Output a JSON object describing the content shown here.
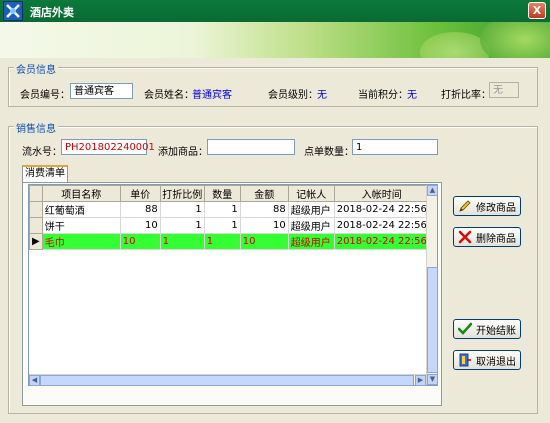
{
  "window": {
    "title": "酒店外卖",
    "close_label": "X"
  },
  "member": {
    "group_title": "会员信息",
    "id_label": "会员编号：",
    "id_value": "普通宾客",
    "name_label": "会员姓名：",
    "name_value": "普通宾客",
    "level_label": "会员级别：",
    "level_value": "无",
    "points_label": "当前积分：",
    "points_value": "无",
    "discount_label": "打折比率：",
    "discount_value": "无"
  },
  "sales": {
    "group_title": "销售信息",
    "serial_label": "流水号：",
    "serial_value": "PH201802240001",
    "add_label": "添加商品：",
    "add_value": "",
    "qty_label": "点单数量：",
    "qty_value": "1"
  },
  "tab": {
    "label": "消费清单"
  },
  "table": {
    "columns": [
      "项目名称",
      "单价",
      "打折比例",
      "数量",
      "金额",
      "记帐人",
      "入帐时间"
    ],
    "rows": [
      {
        "name": "红葡萄酒",
        "price": "88",
        "discount": "1",
        "qty": "1",
        "amount": "88",
        "clerk": "超级用户",
        "time": "2018-02-24 22:56"
      },
      {
        "name": "饼干",
        "price": "10",
        "discount": "1",
        "qty": "1",
        "amount": "10",
        "clerk": "超级用户",
        "time": "2018-02-24 22:56"
      },
      {
        "name": "毛巾",
        "price": "10",
        "discount": "1",
        "qty": "1",
        "amount": "10",
        "clerk": "超级用户",
        "time": "2018-02-24 22:56"
      }
    ]
  },
  "buttons": {
    "edit": "修改商品",
    "delete": "删除商品",
    "checkout": "开始结账",
    "cancel": "取消退出"
  },
  "colors": {
    "accent": "#0c4fb0",
    "value_blue": "#0000dd",
    "selected_row": "#33ff33",
    "selected_text": "#d00000"
  }
}
